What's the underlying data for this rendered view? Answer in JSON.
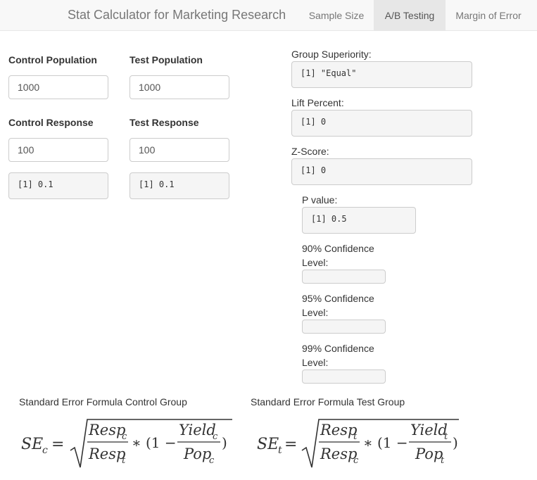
{
  "navbar": {
    "brand": "Stat Calculator for Marketing Research",
    "tabs": [
      {
        "label": "Sample Size",
        "active": false
      },
      {
        "label": "A/B Testing",
        "active": true
      },
      {
        "label": "Margin of Error",
        "active": false
      }
    ]
  },
  "inputs": {
    "control_population": {
      "label": "Control Population",
      "value": "1000"
    },
    "test_population": {
      "label": "Test Population",
      "value": "1000"
    },
    "control_response": {
      "label": "Control Response",
      "value": "100"
    },
    "test_response": {
      "label": "Test Response",
      "value": "100"
    },
    "control_yield_output": "[1] 0.1",
    "test_yield_output": "[1] 0.1"
  },
  "results": {
    "group_superiority": {
      "label": "Group Superiority:",
      "value": "[1] \"Equal\""
    },
    "lift_percent": {
      "label": "Lift Percent:",
      "value": "[1] 0"
    },
    "z_score": {
      "label": "Z-Score:",
      "value": "[1] 0"
    },
    "p_value": {
      "label": "P value:",
      "value": "[1] 0.5"
    },
    "ci90": {
      "label_line1": "90% Confidence",
      "label_line2": "Level:",
      "value": ""
    },
    "ci95": {
      "label_line1": "95% Confidence",
      "label_line2": "Level:",
      "value": ""
    },
    "ci99": {
      "label_line1": "99% Confidence",
      "label_line2": "Level:",
      "value": ""
    }
  },
  "formulas": {
    "control": {
      "title": "Standard Error Formula Control Group",
      "lhs": "SE",
      "lhs_sub": "c",
      "num1": "Resp",
      "num1_sub": "c",
      "den1": "Resp",
      "den1_sub": "t",
      "mid": "∗ (1 −",
      "num2": "Yield",
      "num2_sub": "c",
      "den2": "Pop",
      "den2_sub": "c",
      "close": ")"
    },
    "test": {
      "title": "Standard Error Formula Test Group",
      "lhs": "SE",
      "lhs_sub": "t",
      "num1": "Resp",
      "num1_sub": "t",
      "den1": "Resp",
      "den1_sub": "c",
      "mid": "∗ (1 −",
      "num2": "Yield",
      "num2_sub": "t",
      "den2": "Pop",
      "den2_sub": "t",
      "close": ")"
    }
  }
}
